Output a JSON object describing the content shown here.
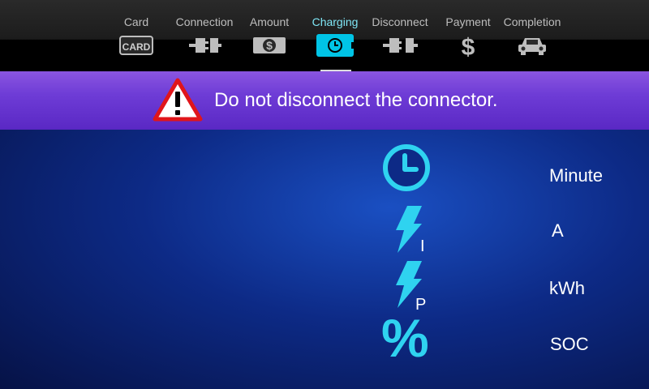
{
  "steps": [
    {
      "label": "Card",
      "icon": "card-icon",
      "icon_text": "CARD"
    },
    {
      "label": "Connection",
      "icon": "plug-icon"
    },
    {
      "label": "Amount",
      "icon": "money-icon",
      "icon_text": "$"
    },
    {
      "label": "Charging",
      "icon": "clock-battery-icon",
      "active": true
    },
    {
      "label": "Disconnect",
      "icon": "unplug-icon"
    },
    {
      "label": "Payment",
      "icon": "dollar-icon",
      "icon_text": "$"
    },
    {
      "label": "Completion",
      "icon": "car-icon"
    }
  ],
  "banner": {
    "message": "Do not disconnect the connector.",
    "icon": "warning-icon"
  },
  "metrics": [
    {
      "icon": "clock-icon",
      "unit": "Minute"
    },
    {
      "icon": "current-icon",
      "sub": "I",
      "unit": "A"
    },
    {
      "icon": "power-icon",
      "sub": "P",
      "unit": "kWh"
    },
    {
      "icon": "percent-icon",
      "glyph": "%",
      "unit": "SOC"
    }
  ],
  "colors": {
    "accent": "#00c4e6",
    "banner": "#6e3cd6",
    "background": "#0d2a86"
  }
}
